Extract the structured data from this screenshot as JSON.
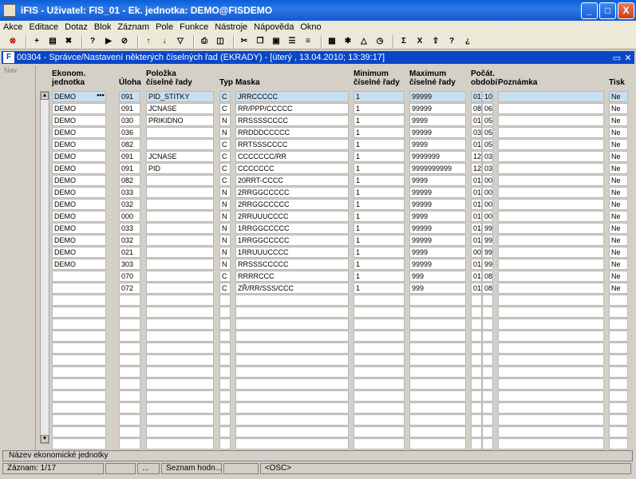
{
  "window": {
    "title": "iFIS - Uživatel: FIS_01 - Ek. jednotka: DEMO@FISDEMO",
    "minimize": "_",
    "maximize": "□",
    "close": "X"
  },
  "menu": [
    "Akce",
    "Editace",
    "Dotaz",
    "Blok",
    "Záznam",
    "Pole",
    "Funkce",
    "Nástroje",
    "Nápověda",
    "Okno"
  ],
  "toolbar_icons": [
    "exit-icon",
    "new-record-icon",
    "save-icon",
    "delete-icon",
    "query-enter-icon",
    "query-execute-icon",
    "query-cancel-icon",
    "sort-ascending-icon",
    "sort-descending-icon",
    "filter-icon",
    "print-icon",
    "print-preview-icon",
    "cut-icon",
    "copy-icon",
    "paste-icon",
    "lov-icon",
    "list-icon",
    "calculator-icon",
    "tools-icon",
    "chart-icon",
    "clock-icon",
    "sum-icon",
    "excel-icon",
    "export-icon",
    "help-icon",
    "context-help-icon"
  ],
  "inner_window": {
    "title": "00304 - Správce/Nastavení některých číselných řad (EKRADY) - [úterý , 13.04.2010; 13:39:17]",
    "restore": "▭",
    "close": "✕"
  },
  "nav_label": "Nav",
  "headers": {
    "ekonom": [
      "Ekonom.",
      "jednotka"
    ],
    "uloha": [
      "",
      "Úloha"
    ],
    "polozka": [
      "Položka",
      "číselné řady"
    ],
    "typ": [
      "",
      "Typ"
    ],
    "maska": [
      "",
      "Maska"
    ],
    "minimum": [
      "Minimum",
      "číselné řady"
    ],
    "maximum": [
      "Maximum",
      "číselné řady"
    ],
    "pocet": [
      "Počát.",
      "období"
    ],
    "poznamka": [
      "",
      "Poznámka"
    ],
    "tisk": [
      "",
      "Tisk"
    ]
  },
  "lov_button": "•••",
  "rows": [
    [
      "DEMO",
      "091",
      "PID_STITKY",
      "C",
      "JRRCCCCC",
      "1",
      "99999",
      "01",
      "10",
      "",
      "Ne"
    ],
    [
      "DEMO",
      "091",
      "JCNASE",
      "C",
      "RR/PPP/CCCCC",
      "1",
      "99999",
      "08",
      "06",
      "",
      "Ne"
    ],
    [
      "DEMO",
      "030",
      "PRIKIDNO",
      "N",
      "RRSSSSCCCC",
      "1",
      "9999",
      "01",
      "05",
      "",
      "Ne"
    ],
    [
      "DEMO",
      "036",
      "",
      "N",
      "RRDDDCCCCC",
      "1",
      "99999",
      "03",
      "05",
      "",
      "Ne"
    ],
    [
      "DEMO",
      "082",
      "",
      "C",
      "RRTSSSCCCC",
      "1",
      "9999",
      "01",
      "05",
      "",
      "Ne"
    ],
    [
      "DEMO",
      "091",
      "JCNASE",
      "C",
      "CCCCCCC/RR",
      "1",
      "9999999",
      "12",
      "03",
      "",
      "Ne"
    ],
    [
      "DEMO",
      "091",
      "PID",
      "C",
      "CCCCCCC",
      "1",
      "9999999999",
      "12",
      "03",
      "",
      "Ne"
    ],
    [
      "DEMO",
      "082",
      "",
      "C",
      "20RRT-CCCC",
      "1",
      "9999",
      "01",
      "00",
      "",
      "Ne"
    ],
    [
      "DEMO",
      "033",
      "",
      "N",
      "2RRGGCCCCC",
      "1",
      "99999",
      "01",
      "00",
      "",
      "Ne"
    ],
    [
      "DEMO",
      "032",
      "",
      "N",
      "2RRGGCCCCC",
      "1",
      "99999",
      "01",
      "00",
      "",
      "Ne"
    ],
    [
      "DEMO",
      "000",
      "",
      "N",
      "2RRUUUCCCC",
      "1",
      "9999",
      "01",
      "00",
      "",
      "Ne"
    ],
    [
      "DEMO",
      "033",
      "",
      "N",
      "1RRGGCCCCC",
      "1",
      "99999",
      "01",
      "99",
      "",
      "Ne"
    ],
    [
      "DEMO",
      "032",
      "",
      "N",
      "1RRGGCCCCC",
      "1",
      "99999",
      "01",
      "99",
      "",
      "Ne"
    ],
    [
      "DEMO",
      "021",
      "",
      "N",
      "1RRUUUCCCC",
      "1",
      "9999",
      "00",
      "99",
      "",
      "Ne"
    ],
    [
      "DEMO",
      "303",
      "",
      "N",
      "RRSSSCCCCC",
      "1",
      "99999",
      "01",
      "99",
      "",
      "Ne"
    ],
    [
      "",
      "070",
      "",
      "C",
      "RRRRCCC",
      "1",
      "999",
      "01",
      "08",
      "",
      "Ne"
    ],
    [
      "",
      "072",
      "",
      "C",
      "ZŘ/RR/SSS/CCC",
      "1",
      "999",
      "01",
      "08",
      "",
      "Ne"
    ],
    [
      "",
      "",
      "",
      "",
      "",
      "",
      "",
      "",
      "",
      "",
      ""
    ],
    [
      "",
      "",
      "",
      "",
      "",
      "",
      "",
      "",
      "",
      "",
      ""
    ],
    [
      "",
      "",
      "",
      "",
      "",
      "",
      "",
      "",
      "",
      "",
      ""
    ],
    [
      "",
      "",
      "",
      "",
      "",
      "",
      "",
      "",
      "",
      "",
      ""
    ],
    [
      "",
      "",
      "",
      "",
      "",
      "",
      "",
      "",
      "",
      "",
      ""
    ],
    [
      "",
      "",
      "",
      "",
      "",
      "",
      "",
      "",
      "",
      "",
      ""
    ],
    [
      "",
      "",
      "",
      "",
      "",
      "",
      "",
      "",
      "",
      "",
      ""
    ],
    [
      "",
      "",
      "",
      "",
      "",
      "",
      "",
      "",
      "",
      "",
      ""
    ],
    [
      "",
      "",
      "",
      "",
      "",
      "",
      "",
      "",
      "",
      "",
      ""
    ],
    [
      "",
      "",
      "",
      "",
      "",
      "",
      "",
      "",
      "",
      "",
      ""
    ],
    [
      "",
      "",
      "",
      "",
      "",
      "",
      "",
      "",
      "",
      "",
      ""
    ],
    [
      "",
      "",
      "",
      "",
      "",
      "",
      "",
      "",
      "",
      "",
      ""
    ],
    [
      "",
      "",
      "",
      "",
      "",
      "",
      "",
      "",
      "",
      "",
      ""
    ]
  ],
  "status": {
    "field_hint": "Název ekonomické jednotky",
    "record": "Záznam: 1/17",
    "empty1": "",
    "dots": "...",
    "lov_hint": "Seznam hodn...",
    "empty2": "",
    "osc": "<OSC>"
  }
}
